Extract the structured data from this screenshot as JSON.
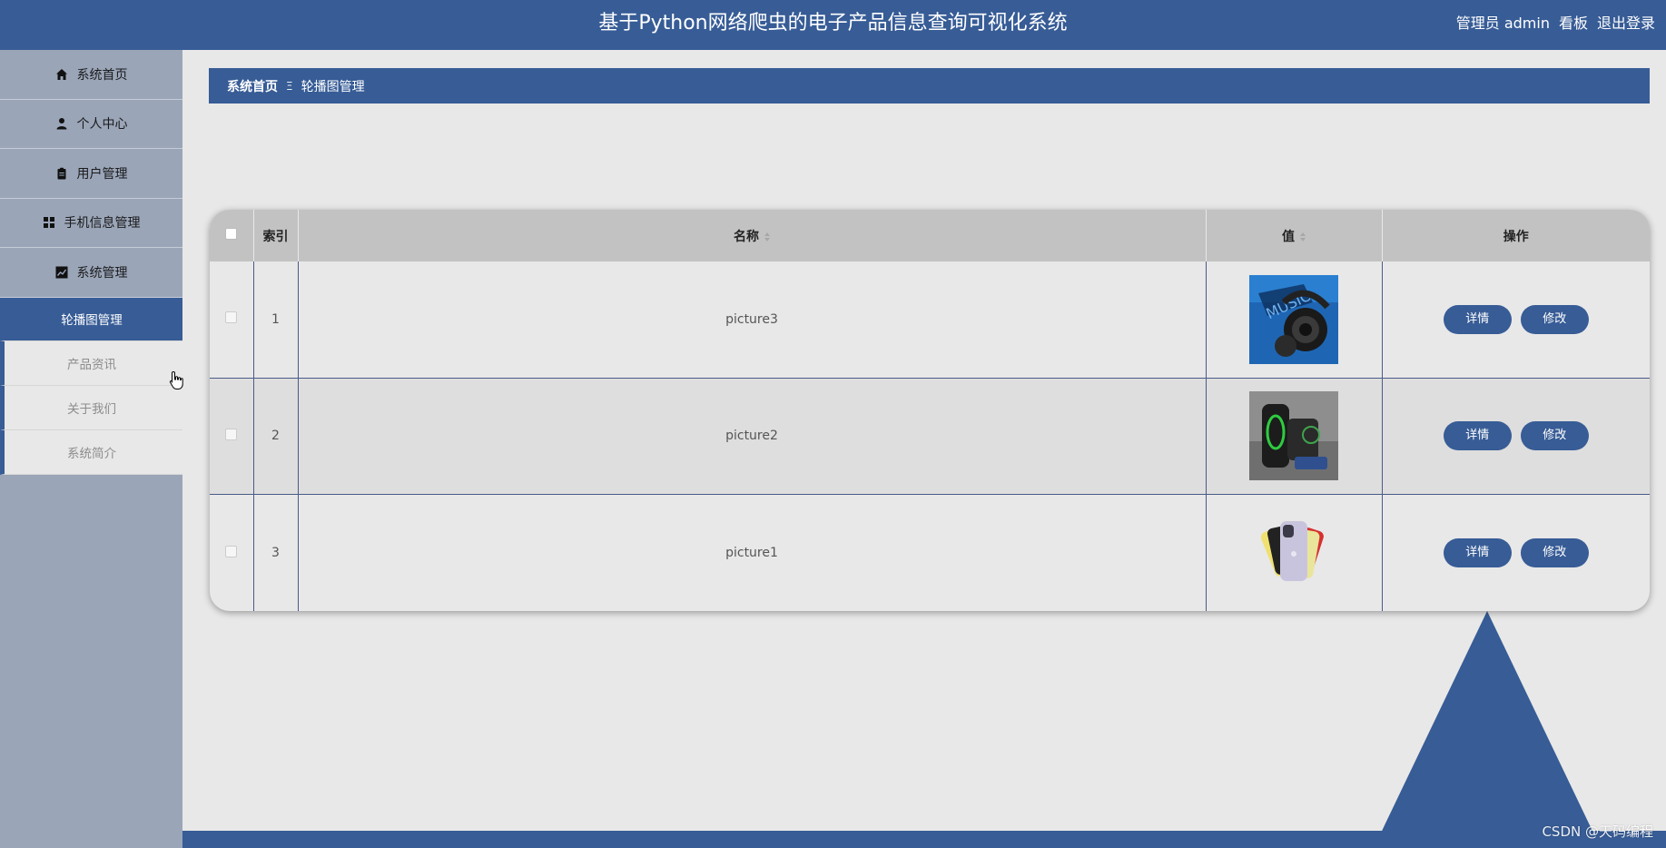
{
  "header": {
    "title": "基于Python网络爬虫的电子产品信息查询可视化系统",
    "admin_label": "管理员 admin",
    "dashboard_label": "看板",
    "logout_label": "退出登录"
  },
  "sidebar": {
    "items": [
      {
        "label": "系统首页",
        "icon": "home-icon"
      },
      {
        "label": "个人中心",
        "icon": "user-icon"
      },
      {
        "label": "用户管理",
        "icon": "clipboard-icon"
      },
      {
        "label": "手机信息管理",
        "icon": "grid-icon"
      },
      {
        "label": "系统管理",
        "icon": "chart-icon"
      }
    ],
    "sub_items": [
      {
        "label": "轮播图管理",
        "active": true
      },
      {
        "label": "产品资讯",
        "active": false
      },
      {
        "label": "关于我们",
        "active": false
      },
      {
        "label": "系统简介",
        "active": false
      }
    ]
  },
  "breadcrumb": {
    "home": "系统首页",
    "separator": "Ξ",
    "current": "轮播图管理"
  },
  "table": {
    "columns": {
      "index": "索引",
      "name": "名称",
      "value": "值",
      "actions": "操作"
    },
    "rows": [
      {
        "index": "1",
        "name": "picture3",
        "image": "headphones-photo"
      },
      {
        "index": "2",
        "name": "picture2",
        "image": "charging-dock-photo"
      },
      {
        "index": "3",
        "name": "picture1",
        "image": "iphone-photo"
      }
    ],
    "detail_label": "详情",
    "edit_label": "修改"
  },
  "watermark": "CSDN @天码编程",
  "colors": {
    "primary": "#375c96",
    "sidebar": "#9aa5b8",
    "background": "#e8e8e8",
    "table_header": "#c2c2c2"
  }
}
